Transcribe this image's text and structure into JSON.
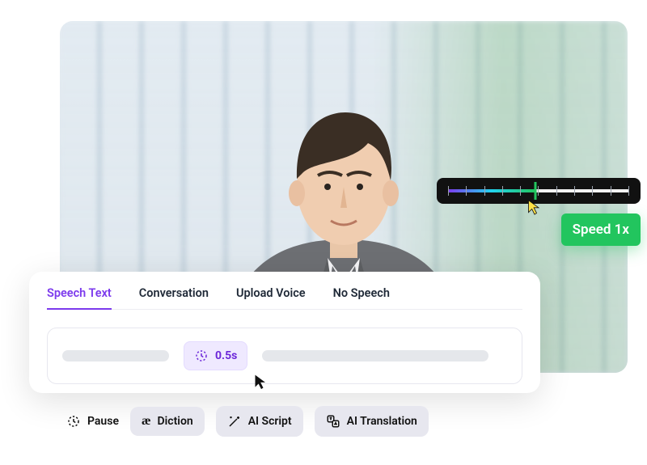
{
  "tabs": {
    "speech_text": "Speech Text",
    "conversation": "Conversation",
    "upload_voice": "Upload Voice",
    "no_speech": "No Speech"
  },
  "pause_chip": {
    "label": "0.5s"
  },
  "speed": {
    "badge": "Speed 1x"
  },
  "actions": {
    "pause": "Pause",
    "diction": "Diction",
    "ai_script": "AI Script",
    "ai_translation": "AI Translation"
  },
  "colors": {
    "accent": "#7c3aed",
    "green": "#22c55e"
  }
}
